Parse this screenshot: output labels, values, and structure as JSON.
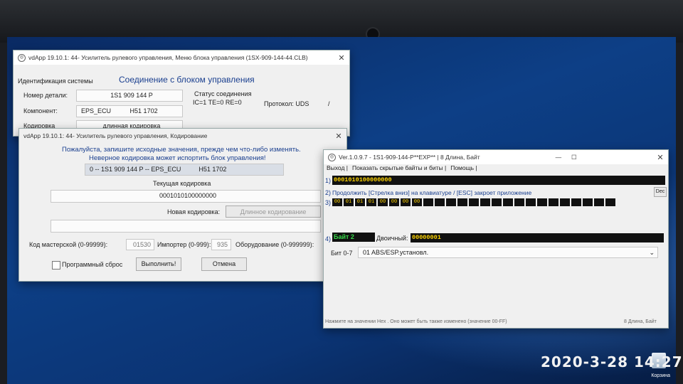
{
  "win1": {
    "title": "vdApp 19.10.1: 44- Усилитель рулевого управления,  Меню блока управления (1SX-909-144-44.CLB)",
    "system_id_label": "Идентификация системы",
    "heading": "Соединение с блоком управления",
    "part_label": "Номер детали:",
    "part_value": "1S1 909 144 P",
    "component_label": "Компонент:",
    "component_value": "EPS_ECU",
    "component_version": "H51 1702",
    "coding_label": "Кодировка",
    "coding_value": "длинная кодировка",
    "status_label": "Статус соединения",
    "status_value": "IC=1  TE=0   RE=0",
    "protocol_label": "Протокол: UDS",
    "protocol_extra": "/"
  },
  "win2": {
    "title": "vdApp 19.10.1: 44- Усилитель рулевого управления,  Кодирование",
    "warning1": "Пожалуйста, запишите исходные значения, прежде чем что-либо изменять.",
    "warning2": "Неверное кодировка может испортить блок управления!",
    "ecu_line": "0 -- 1S1 909 144 P -- EPS_ECU          H51 1702",
    "current_label": "Текущая кодировка",
    "current_value": "0001010100000000",
    "new_label": "Новая кодировка:",
    "long_btn": "Длинное кодирование",
    "new_value": "",
    "workshop_label": "Код мастерской (0-99999):",
    "workshop_value": "01530",
    "importer_label": "Импортер (0-999):",
    "importer_value": "935",
    "equipment_label": "Оборудование (0-999999):",
    "reset_label": "Программный сброс",
    "execute_btn": "Выполнить!",
    "cancel_btn": "Отмена"
  },
  "win3": {
    "title": "Ver.1.0.9.7  -   1S1-909-144-P**EXP** | 8 Длина, Байт",
    "menu": [
      "Выход |",
      "Показать скрытые байты и биты |",
      "Помощь |"
    ],
    "row1_num": "1)",
    "row1_value": "0001010100000000",
    "row2_num": "2)",
    "row2_text": "Продолжить [Стрелка вниз] на клавиатуре / [ESC] закроет приложение",
    "dec_btn": "Dec",
    "row3_num": "3)",
    "bytes": [
      "00",
      "01",
      "01",
      "01",
      "00",
      "00",
      "00",
      "00"
    ],
    "row4_num": "4)",
    "byte_label": "Байт 2",
    "binary_label": "Двоичный:",
    "binary_value": "00000001",
    "bit_label": "Бит 0-7",
    "bit_value": "01 ABS/ESP.установл.",
    "status_left": "Нажмите на значении Hex . Оно может быть также изменено (значение 00-FF)",
    "status_right": "8 Длина, Байт"
  },
  "desktop": {
    "recycle_label": "Корзина"
  },
  "timestamp": "2020-3-28  14:27"
}
